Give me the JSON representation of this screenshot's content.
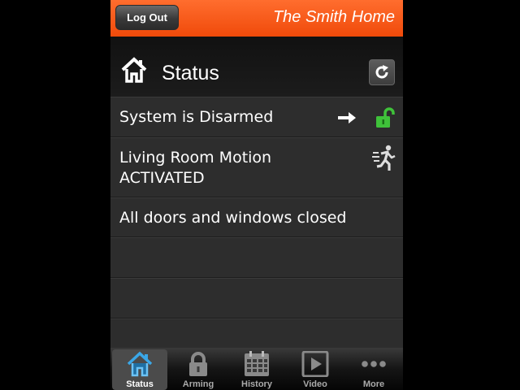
{
  "top_bar": {
    "logout_label": "Log Out",
    "home_name": "The Smith Home"
  },
  "header": {
    "title": "Status",
    "title_icon": "house-icon",
    "refresh_icon": "refresh-icon"
  },
  "status_rows": [
    {
      "text": "System is Disarmed",
      "icons": [
        "arrow-right-icon",
        "unlocked-padlock-icon"
      ]
    },
    {
      "line1": "Living Room Motion",
      "line2": "ACTIVATED",
      "icon": "running-person-icon"
    },
    {
      "text": "All doors and windows closed"
    }
  ],
  "tab_bar": {
    "tabs": [
      {
        "label": "Status",
        "icon": "house-icon",
        "selected": true
      },
      {
        "label": "Arming",
        "icon": "padlock-icon",
        "selected": false
      },
      {
        "label": "History",
        "icon": "calendar-icon",
        "selected": false
      },
      {
        "label": "Video",
        "icon": "play-icon",
        "selected": false
      },
      {
        "label": "More",
        "icon": "ellipsis-icon",
        "selected": false
      }
    ]
  },
  "colors": {
    "top_bar": "#f45a1c",
    "lock_green": "#3fc23a",
    "active_tab_icon": "#3aa7e8"
  }
}
